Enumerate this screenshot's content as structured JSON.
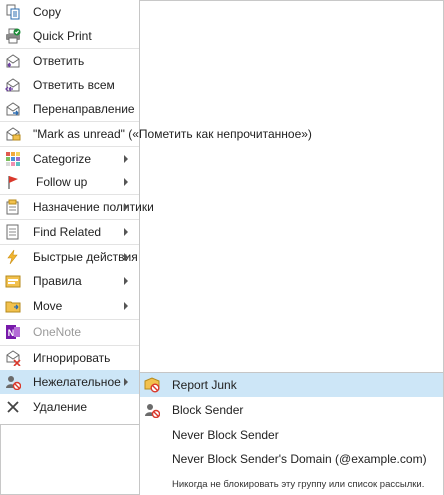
{
  "menu": {
    "items": [
      {
        "label": "Copy",
        "icon": "copy-icon"
      },
      {
        "label": "Quick Print",
        "icon": "quick-print-icon"
      },
      {
        "label": "Ответить",
        "icon": "reply-icon"
      },
      {
        "label": "Ответить всем",
        "icon": "reply-all-icon"
      },
      {
        "label": "Перенаправление",
        "icon": "forward-icon"
      },
      {
        "label": "\"Mark as unread\" («Пометить как непрочитанное»)",
        "icon": "mark-unread-icon"
      },
      {
        "label": "Categorize",
        "icon": "categorize-icon"
      },
      {
        "label": "Follow up",
        "icon": "follow-up-flag-icon"
      },
      {
        "label": "Назначение политики",
        "icon": "assign-policy-icon"
      },
      {
        "label": "Find Related",
        "icon": "find-related-icon"
      },
      {
        "label": "Быстрые действия",
        "icon": "quick-steps-icon"
      },
      {
        "label": "Правила",
        "icon": "rules-icon"
      },
      {
        "label": "Move",
        "icon": "move-icon"
      },
      {
        "label": "OneNote",
        "icon": "onenote-icon"
      },
      {
        "label": "Игнорировать",
        "icon": "ignore-icon"
      },
      {
        "label": "Нежелательное",
        "icon": "junk-icon"
      },
      {
        "label": "Удаление",
        "icon": "delete-icon"
      }
    ]
  },
  "submenu": {
    "items": [
      {
        "label": "Report Junk",
        "icon": "report-junk-icon"
      },
      {
        "label": "Block Sender",
        "icon": "block-sender-icon"
      },
      {
        "label": "Never Block Sender"
      },
      {
        "label": "Never Block Sender's Domain (@example.com)"
      }
    ],
    "note": "Никогда не блокировать эту группу или список рассылки."
  },
  "colors": {
    "hover": "#cde6f7",
    "border": "#c6c6c6",
    "separator": "#e3e3e3"
  }
}
